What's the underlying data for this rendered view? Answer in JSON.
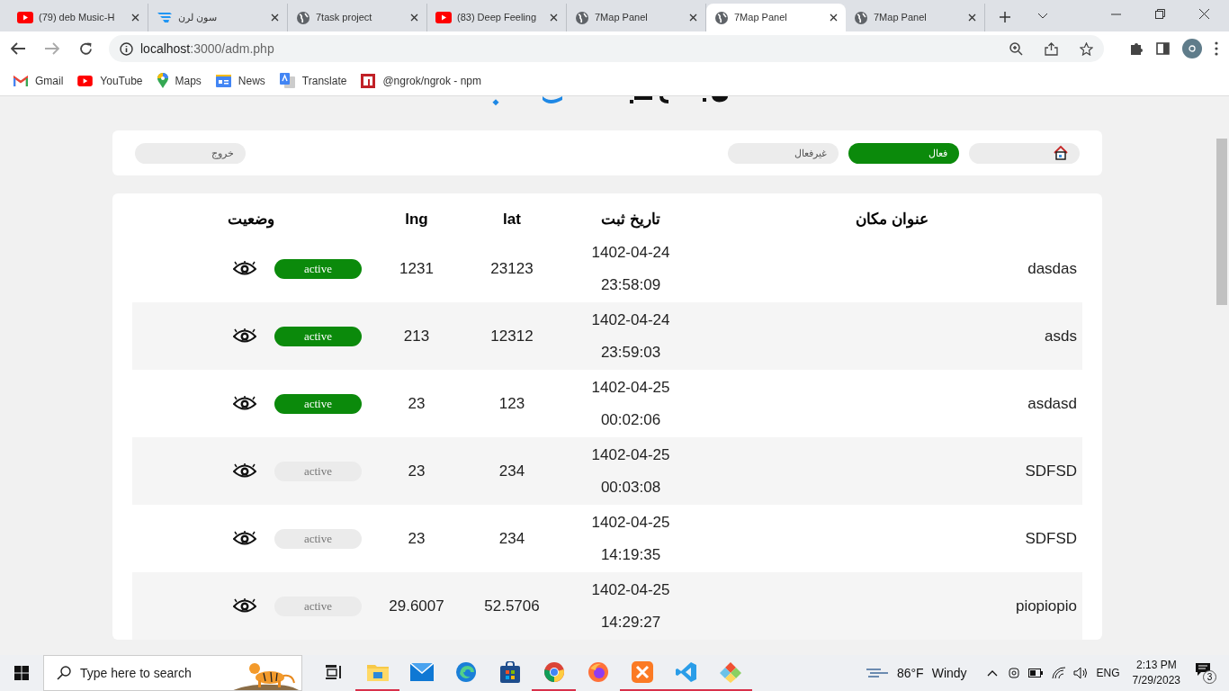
{
  "browser_tabs": [
    {
      "title": "(79) deb Music-H",
      "kind": "youtube",
      "selected": false
    },
    {
      "title": "سون لرن",
      "kind": "feather",
      "selected": false
    },
    {
      "title": "7task project",
      "kind": "globe",
      "selected": false
    },
    {
      "title": "(83) Deep Feeling",
      "kind": "youtube",
      "selected": false
    },
    {
      "title": "7Map Panel",
      "kind": "globe",
      "selected": false
    },
    {
      "title": "7Map Panel",
      "kind": "globe",
      "selected": true
    },
    {
      "title": "7Map Panel",
      "kind": "globe",
      "selected": false
    }
  ],
  "address_bar": {
    "url_host": "localhost",
    "url_rest": ":3000/adm.php"
  },
  "bookmarks": [
    {
      "label": "Gmail",
      "kind": "gmail"
    },
    {
      "label": "YouTube",
      "kind": "youtube"
    },
    {
      "label": "Maps",
      "kind": "maps"
    },
    {
      "label": "News",
      "kind": "news"
    },
    {
      "label": "Translate",
      "kind": "translate"
    },
    {
      "label": "@ngrok/ngrok - npm",
      "kind": "npm"
    }
  ],
  "nav": {
    "items": [
      {
        "kind": "home",
        "selected": false
      },
      {
        "kind": "text",
        "label": "فعال",
        "selected": true
      },
      {
        "kind": "text",
        "label": "غیرفعال",
        "selected": false
      }
    ],
    "logout": "خروج"
  },
  "table": {
    "columns": [
      "عنوان مکان",
      "تاریخ ثبت",
      "lat",
      "lng",
      "وضعیت"
    ],
    "rows": [
      {
        "title": "dasdas",
        "date": "1402-04-24",
        "time": "23:58:09",
        "lat": "23123",
        "lng": "1231",
        "status": "active",
        "active": true
      },
      {
        "title": "asds",
        "date": "1402-04-24",
        "time": "23:59:03",
        "lat": "12312",
        "lng": "213",
        "status": "active",
        "active": true
      },
      {
        "title": "asdasd",
        "date": "1402-04-25",
        "time": "00:02:06",
        "lat": "123",
        "lng": "23",
        "status": "active",
        "active": true
      },
      {
        "title": "SDFSD",
        "date": "1402-04-25",
        "time": "00:03:08",
        "lat": "234",
        "lng": "23",
        "status": "active",
        "active": false
      },
      {
        "title": "SDFSD",
        "date": "1402-04-25",
        "time": "14:19:35",
        "lat": "234",
        "lng": "23",
        "status": "active",
        "active": false
      },
      {
        "title": "piopiopio",
        "date": "1402-04-25",
        "time": "14:29:27",
        "lat": "52.5706",
        "lng": "29.6007",
        "status": "active",
        "active": false
      }
    ]
  },
  "taskbar": {
    "search_placeholder": "Type here to search",
    "apps": [
      {
        "kind": "taskview",
        "running": false
      },
      {
        "kind": "explorer",
        "running": true
      },
      {
        "kind": "mail",
        "running": false
      },
      {
        "kind": "edge",
        "running": false
      },
      {
        "kind": "store",
        "running": false
      },
      {
        "kind": "chrome",
        "running": true
      },
      {
        "kind": "firefox",
        "running": false
      },
      {
        "kind": "xampp",
        "running": true
      },
      {
        "kind": "vscode",
        "running": true
      },
      {
        "kind": "git",
        "running": true
      }
    ],
    "weather_temp": "86°F",
    "weather_text": "Windy",
    "language": "ENG",
    "time": "2:13 PM",
    "date": "7/29/2023",
    "notifications": "3"
  }
}
